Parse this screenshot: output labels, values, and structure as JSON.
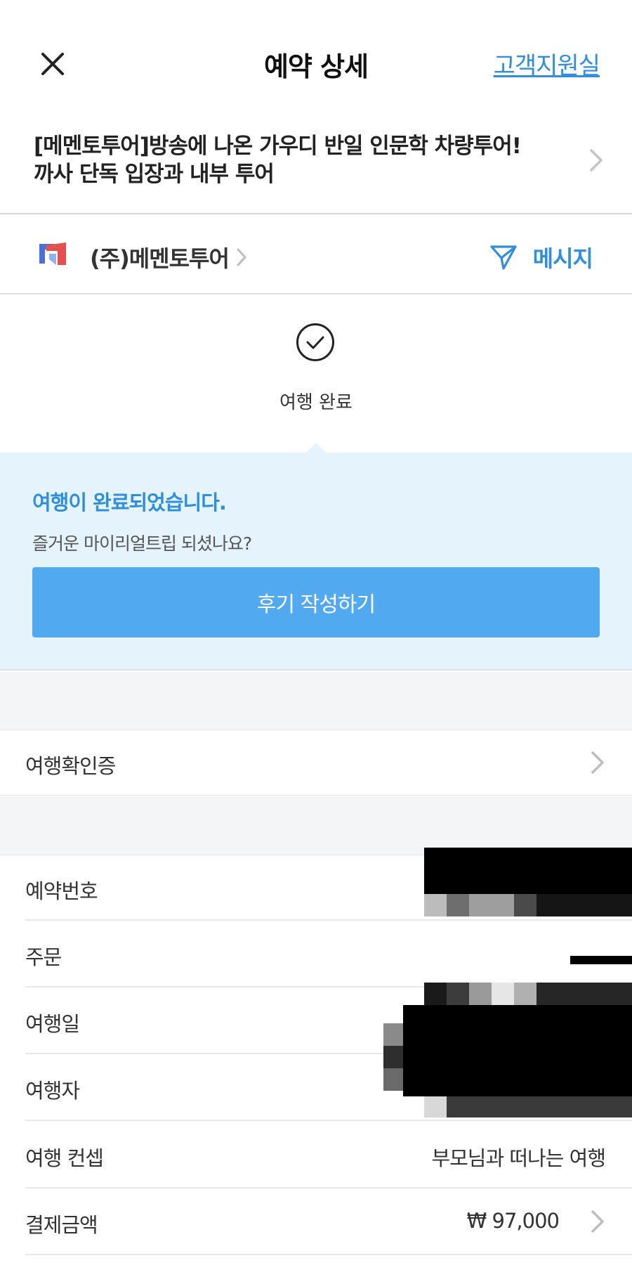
{
  "header": {
    "title": "예약 상세",
    "support_label": "고객지원실",
    "close_icon": "close-icon"
  },
  "product": {
    "title_line1": "[메멘토투어]방송에 나온 가우디 반일 인문학 차량투어!",
    "title_line2": "까사 단독 입장과 내부 투어"
  },
  "seller": {
    "name": "(주)메멘토투어",
    "message_label": "메시지",
    "logo_colors": [
      "#e54f4f",
      "#4a6fd8",
      "#8fb0f2"
    ]
  },
  "status": {
    "label": "여행 완료"
  },
  "notice": {
    "title": "여행이 완료되었습니다.",
    "subtitle": "즐거운 마이리얼트립 되셨나요?",
    "review_button": "후기 작성하기"
  },
  "certificate": {
    "label": "여행확인증"
  },
  "details": {
    "reservation_number_label": "예약번호",
    "order_label": "주문",
    "travel_date_label": "여행일",
    "traveler_label": "여행자",
    "concept_label": "여행 컨셉",
    "concept_value": "부모님과 떠나는 여행",
    "payment_label": "결제금액",
    "payment_value": "₩ 97,000"
  },
  "colors": {
    "accent": "#2f8fdc",
    "button": "#51aaf0",
    "notice_bg": "#e5f3fc",
    "band_bg": "#f4f5f6"
  }
}
